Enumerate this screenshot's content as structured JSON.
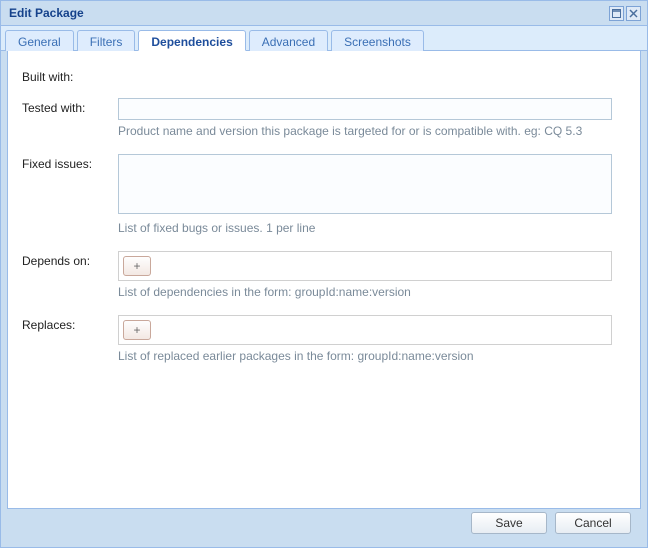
{
  "title": "Edit Package",
  "tabs": {
    "general": "General",
    "filters": "Filters",
    "dependencies": "Dependencies",
    "advanced": "Advanced",
    "screenshots": "Screenshots"
  },
  "labels": {
    "built_with": "Built with:",
    "tested_with": "Tested with:",
    "fixed_issues": "Fixed issues:",
    "depends_on": "Depends on:",
    "replaces": "Replaces:"
  },
  "help": {
    "tested_with": "Product name and version this package is targeted for or is compatible with. eg: CQ 5.3",
    "fixed_issues": "List of fixed bugs or issues. 1 per line",
    "depends_on": "List of dependencies in the form: groupId:name:version",
    "replaces": "List of replaced earlier packages in the form: groupId:name:version"
  },
  "values": {
    "tested_with": "",
    "fixed_issues": "",
    "depends_on": [],
    "replaces": []
  },
  "icons": {
    "add": "+"
  },
  "buttons": {
    "save": "Save",
    "cancel": "Cancel"
  }
}
